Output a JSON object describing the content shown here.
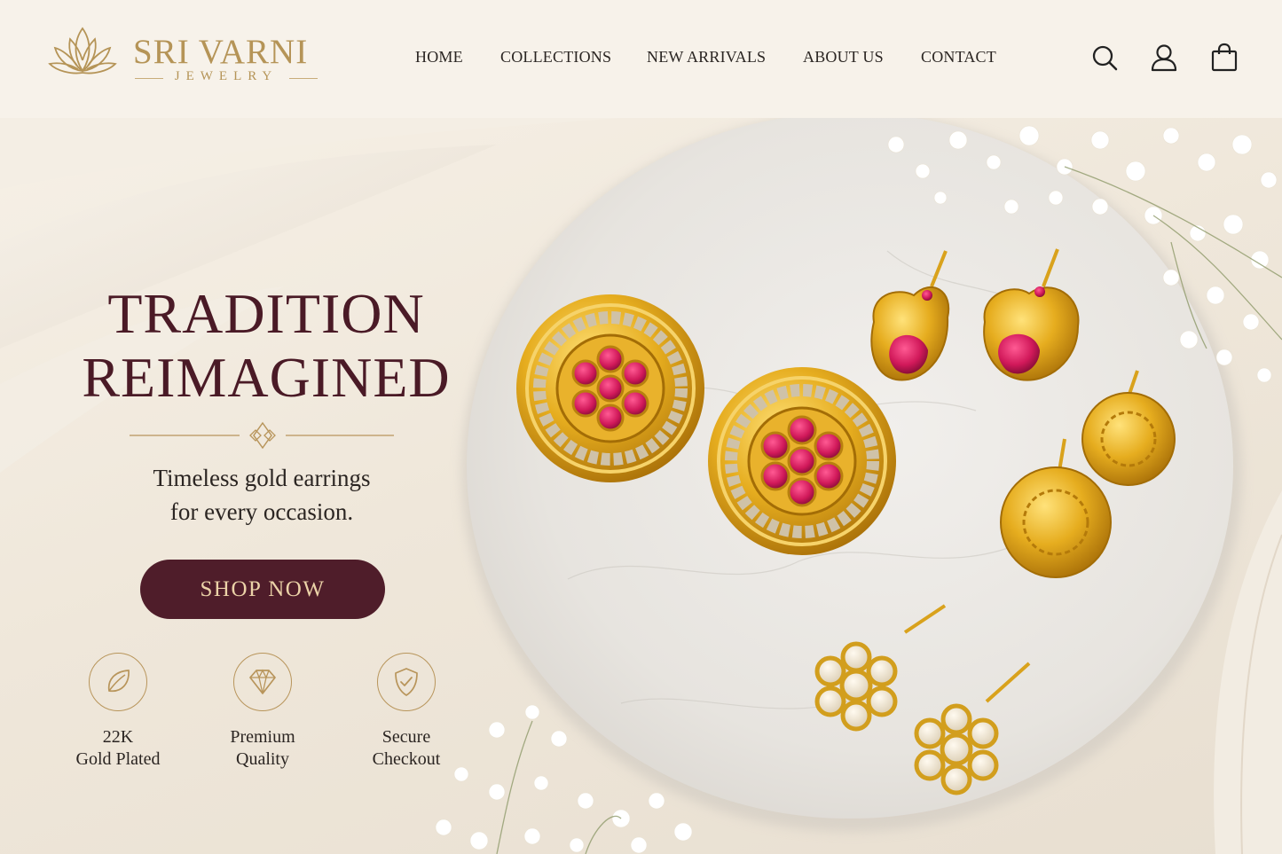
{
  "brand": {
    "name": "SRI VARNI",
    "subtitle": "JEWELRY"
  },
  "nav": {
    "items": [
      {
        "label": "HOME"
      },
      {
        "label": "COLLECTIONS"
      },
      {
        "label": "NEW ARRIVALS"
      },
      {
        "label": "ABOUT US"
      },
      {
        "label": "CONTACT"
      }
    ]
  },
  "header_icons": [
    "search-icon",
    "account-icon",
    "shopping-bag-icon"
  ],
  "hero": {
    "headline_line1": "TRADITION",
    "headline_line2": "REIMAGINED",
    "tagline_line1": "Timeless gold earrings",
    "tagline_line2": "for every occasion.",
    "cta_label": "SHOP NOW"
  },
  "features": [
    {
      "icon": "leaf-icon",
      "line1": "22K",
      "line2": "Gold Plated"
    },
    {
      "icon": "diamond-icon",
      "line1": "Premium",
      "line2": "Quality"
    },
    {
      "icon": "shield-check-icon",
      "line1": "Secure",
      "line2": "Checkout"
    }
  ],
  "colors": {
    "header_bg": "#f7f2ea",
    "gold": "#b59457",
    "maroon": "#4f1d2a",
    "headline": "#4a1a26",
    "ruby": "#d1195a",
    "earring_gold": "#e0a81e"
  }
}
